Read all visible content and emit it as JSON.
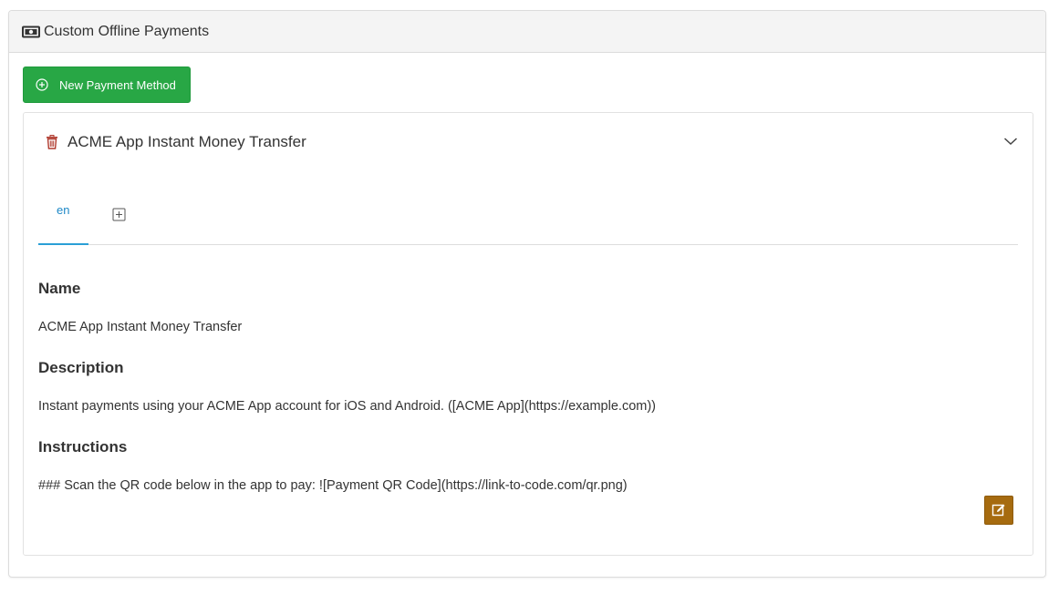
{
  "card": {
    "title": "Custom Offline Payments",
    "icon": "money-bill-icon"
  },
  "toolbar": {
    "new_button_label": "New Payment Method",
    "new_button_icon": "plus-circle-icon",
    "new_button_color": "#28a745"
  },
  "method": {
    "title": "ACME App Instant Money Transfer",
    "delete_icon": "trash-icon",
    "collapse_icon": "chevron-down-icon",
    "tabs": [
      {
        "label": "en",
        "active": true
      }
    ],
    "add_language_icon": "plus-square-icon",
    "fields": {
      "name_label": "Name",
      "name_value": "ACME App Instant Money Transfer",
      "description_label": "Description",
      "description_value": "Instant payments using your ACME App account for iOS and Android. ([ACME App](https://example.com))",
      "instructions_label": "Instructions",
      "instructions_value": "### Scan the QR code below in the app to pay: ![Payment QR Code](https://link-to-code.com/qr.png)"
    },
    "edit_icon": "edit-icon",
    "edit_button_color": "#a66b0f"
  }
}
